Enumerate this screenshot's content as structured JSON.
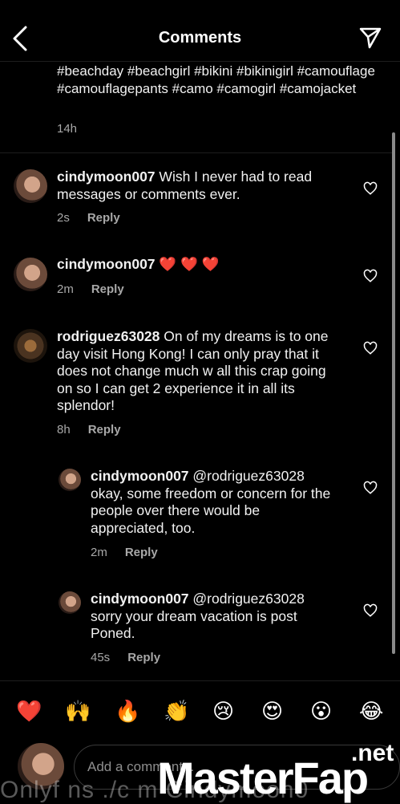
{
  "header": {
    "title": "Comments"
  },
  "caption": {
    "text": "#beachday #beachgirl #bikini #bikinigirl #camouflage #camouflagepants #camo #camogirl #camojacket",
    "time": "14h"
  },
  "comments": [
    {
      "user": "cindymoon007",
      "text": "Wish I never had to read messages or comments ever.",
      "time": "2s",
      "reply": "Reply"
    },
    {
      "user": "cindymoon007",
      "text": "❤️ ❤️ ❤️",
      "time": "2m",
      "reply": "Reply"
    },
    {
      "user": "rodriguez63028",
      "text": "On of my dreams is to one day visit Hong Kong! I can only pray that it does not change much w all this crap going on so I can get 2 experience it in all its splendor!",
      "time": "8h",
      "reply": "Reply"
    },
    {
      "user": "cindymoon007",
      "text": "@rodriguez63028 okay, some freedom or concern for the people over there would be appreciated, too.",
      "time": "2m",
      "reply": "Reply"
    },
    {
      "user": "cindymoon007",
      "text": "@rodriguez63028 sorry your dream vacation is post Poned.",
      "time": "45s",
      "reply": "Reply"
    }
  ],
  "emojis": [
    "❤️",
    "🙌",
    "🔥",
    "👏",
    "😢",
    "😍",
    "😮",
    "😂"
  ],
  "composer": {
    "placeholder": "Add a comment..."
  },
  "watermark": {
    "left": "Onlyf ns ./c m Cindymoon0",
    "brand": "MasterFap",
    "net": ".net"
  }
}
